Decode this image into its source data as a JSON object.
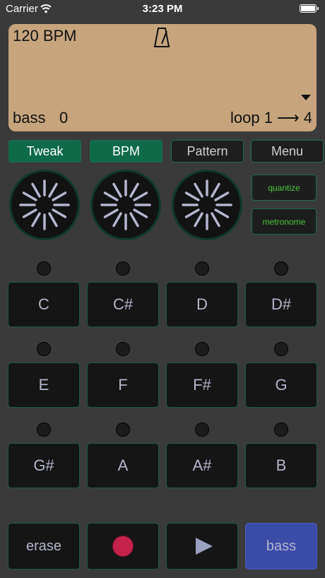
{
  "status": {
    "carrier": "Carrier",
    "time": "3:23 PM"
  },
  "display": {
    "bpm": "120 BPM",
    "track_name": "bass",
    "track_value": "0",
    "loop": "loop  1 ⟶ 4"
  },
  "modes": [
    "Tweak",
    "BPM",
    "Pattern",
    "Menu"
  ],
  "toggles": {
    "quantize": "quantize",
    "metronome": "metronome"
  },
  "pads": [
    "C",
    "C#",
    "D",
    "D#",
    "E",
    "F",
    "F#",
    "G",
    "G#",
    "A",
    "A#",
    "B"
  ],
  "controls": {
    "erase": "erase",
    "track": "bass"
  },
  "colors": {
    "display_bg": "#c7a47c",
    "active_mode": "#0e6b4a",
    "record": "#c4224a",
    "track_button": "#3a4ba8"
  }
}
